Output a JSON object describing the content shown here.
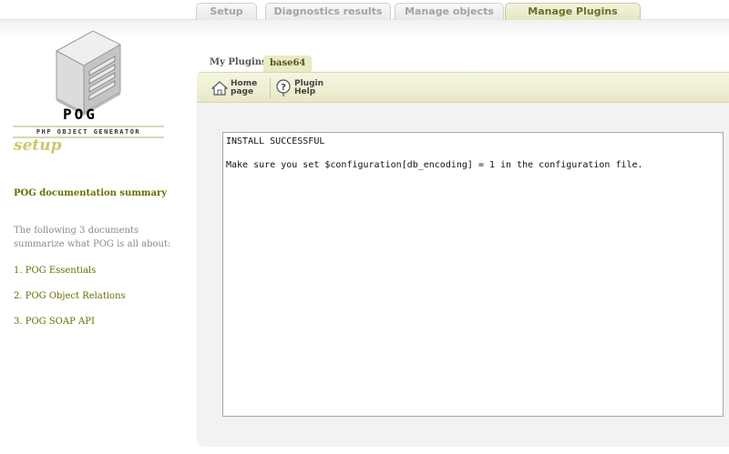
{
  "top_tabs": [
    {
      "label": "Setup",
      "active": false
    },
    {
      "label": "Diagnostics results",
      "active": false
    },
    {
      "label": "Manage objects",
      "active": false
    },
    {
      "label": "Manage Plugins",
      "active": true
    }
  ],
  "logo": {
    "brand": "POG",
    "tagline": "PHP OBJECT GENERATOR",
    "subtitle": "setup"
  },
  "sidebar": {
    "doc_title": "POG documentation summary",
    "doc_intro": "The following 3 documents summarize what POG is all about:",
    "docs": [
      "1. POG Essentials",
      "2. POG Object Relations",
      "3. POG SOAP API"
    ]
  },
  "plugins": {
    "label": "My Plugins:",
    "active_plugin": "base64"
  },
  "toolbar": {
    "home_label": "Home\npage",
    "help_label": "Plugin\nHelp"
  },
  "output": {
    "line1": "INSTALL SUCCESSFUL",
    "line2": "Make sure you set $configuration[db_encoding] = 1 in the configuration file."
  },
  "colors": {
    "accent": "#6c6c00",
    "toolbar": "#eeeed2"
  }
}
